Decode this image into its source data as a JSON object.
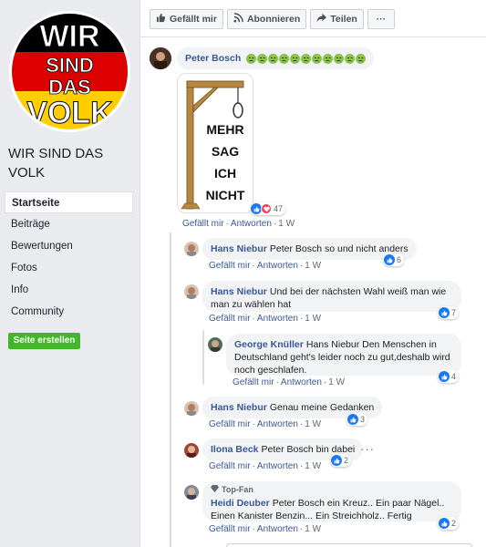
{
  "sidebar": {
    "page_name": "WIR SIND DAS VOLK",
    "logo_words": [
      "WIR",
      "SIND",
      "DAS",
      "VOLK"
    ],
    "nav": [
      "Startseite",
      "Beiträge",
      "Bewertungen",
      "Fotos",
      "Info",
      "Community"
    ],
    "create_button": "Seite erstellen"
  },
  "actions": {
    "like": "Gefällt mir",
    "follow": "Abonnieren",
    "share": "Teilen",
    "more": "···"
  },
  "post_comment": {
    "author": "Peter Bosch",
    "image_text": [
      "MEHR",
      "SAG",
      "ICH",
      "NICHT"
    ],
    "reaction_count": "47",
    "like_label": "Gefällt mir",
    "reply_label": "Antworten",
    "time": "1 W"
  },
  "replies": [
    {
      "author": "Hans Niebur",
      "text": "Peter Bosch so und nicht anders",
      "time": "1 W",
      "reactions": "6"
    },
    {
      "author": "Hans Niebur",
      "text": "Und bei der nächsten Wahl weiß man wie man zu wählen hat",
      "time": "1 W",
      "reactions": "7"
    },
    {
      "author": "George Knüller",
      "text": "Hans Niebur Den Menschen in Deutschland geht's leider noch zu gut,deshalb wird noch geschlafen.",
      "time": "1 W",
      "reactions": "4"
    },
    {
      "author": "Hans Niebur",
      "text": "Genau meine Gedanken",
      "time": "1 W",
      "reactions": "3"
    },
    {
      "author": "Ilona Beck",
      "text": "Peter Bosch bin dabei",
      "time": "1 W",
      "reactions": "2"
    },
    {
      "author": "Heidi Deuber",
      "badge": "Top-Fan",
      "text": "Peter Bosch ein Kreuz.. Ein paar Nägel.. Einen Kanister Benzin... Ein Streichholz.. Fertig",
      "time": "1 W",
      "reactions": "2"
    }
  ],
  "colors": {
    "link": "#385898",
    "like_blue": "#1877f2",
    "heart": "#f33e58",
    "create_green": "#42b72a",
    "bubble": "#f2f3f5"
  }
}
